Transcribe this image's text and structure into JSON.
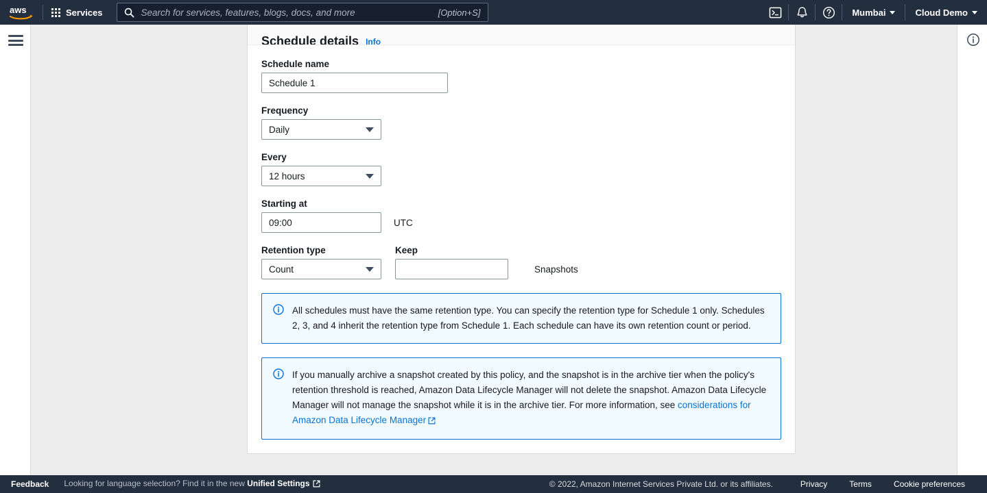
{
  "topnav": {
    "logo_alt": "aws",
    "services_label": "Services",
    "search": {
      "placeholder": "Search for services, features, blogs, docs, and more",
      "value": "",
      "shortcut": "[Option+S]"
    },
    "cloudshell_title": "CloudShell",
    "notifications_title": "Notifications",
    "help_title": "Help",
    "region_label": "Mumbai",
    "account_label": "Cloud Demo"
  },
  "container": {
    "title": "Schedule details",
    "info_label": "Info"
  },
  "form": {
    "schedule_name": {
      "label": "Schedule name",
      "value": "Schedule 1",
      "placeholder": ""
    },
    "frequency": {
      "label": "Frequency",
      "value": "Daily"
    },
    "every": {
      "label": "Every",
      "value": "12 hours"
    },
    "starting_at": {
      "label": "Starting at",
      "value": "09:00",
      "placeholder": "",
      "timezone": "UTC"
    },
    "retention_type": {
      "label": "Retention type",
      "value": "Count"
    },
    "keep": {
      "label": "Keep",
      "value": "",
      "placeholder": "",
      "unit": "Snapshots"
    }
  },
  "alerts": [
    {
      "icon": "info-icon",
      "text": "All schedules must have the same retention type. You can specify the retention type for Schedule 1 only. Schedules 2, 3, and 4 inherit the retention type from Schedule 1. Each schedule can have its own retention count or period.",
      "link_text": ""
    },
    {
      "icon": "info-icon",
      "text": "If you manually archive a snapshot created by this policy, and the snapshot is in the archive tier when the policy's retention threshold is reached, Amazon Data Lifecycle Manager will not delete the snapshot. Amazon Data Lifecycle Manager will not manage the snapshot while it is in the archive tier. For more information, see ",
      "link_text": "considerations for Amazon Data Lifecycle Manager"
    }
  ],
  "footer": {
    "feedback": "Feedback",
    "language_prefix": "Looking for language selection? Find it in the new ",
    "language_link": "Unified Settings",
    "copyright": "© 2022, Amazon Internet Services Private Ltd. or its affiliates.",
    "links": [
      "Privacy",
      "Terms",
      "Cookie preferences"
    ]
  }
}
